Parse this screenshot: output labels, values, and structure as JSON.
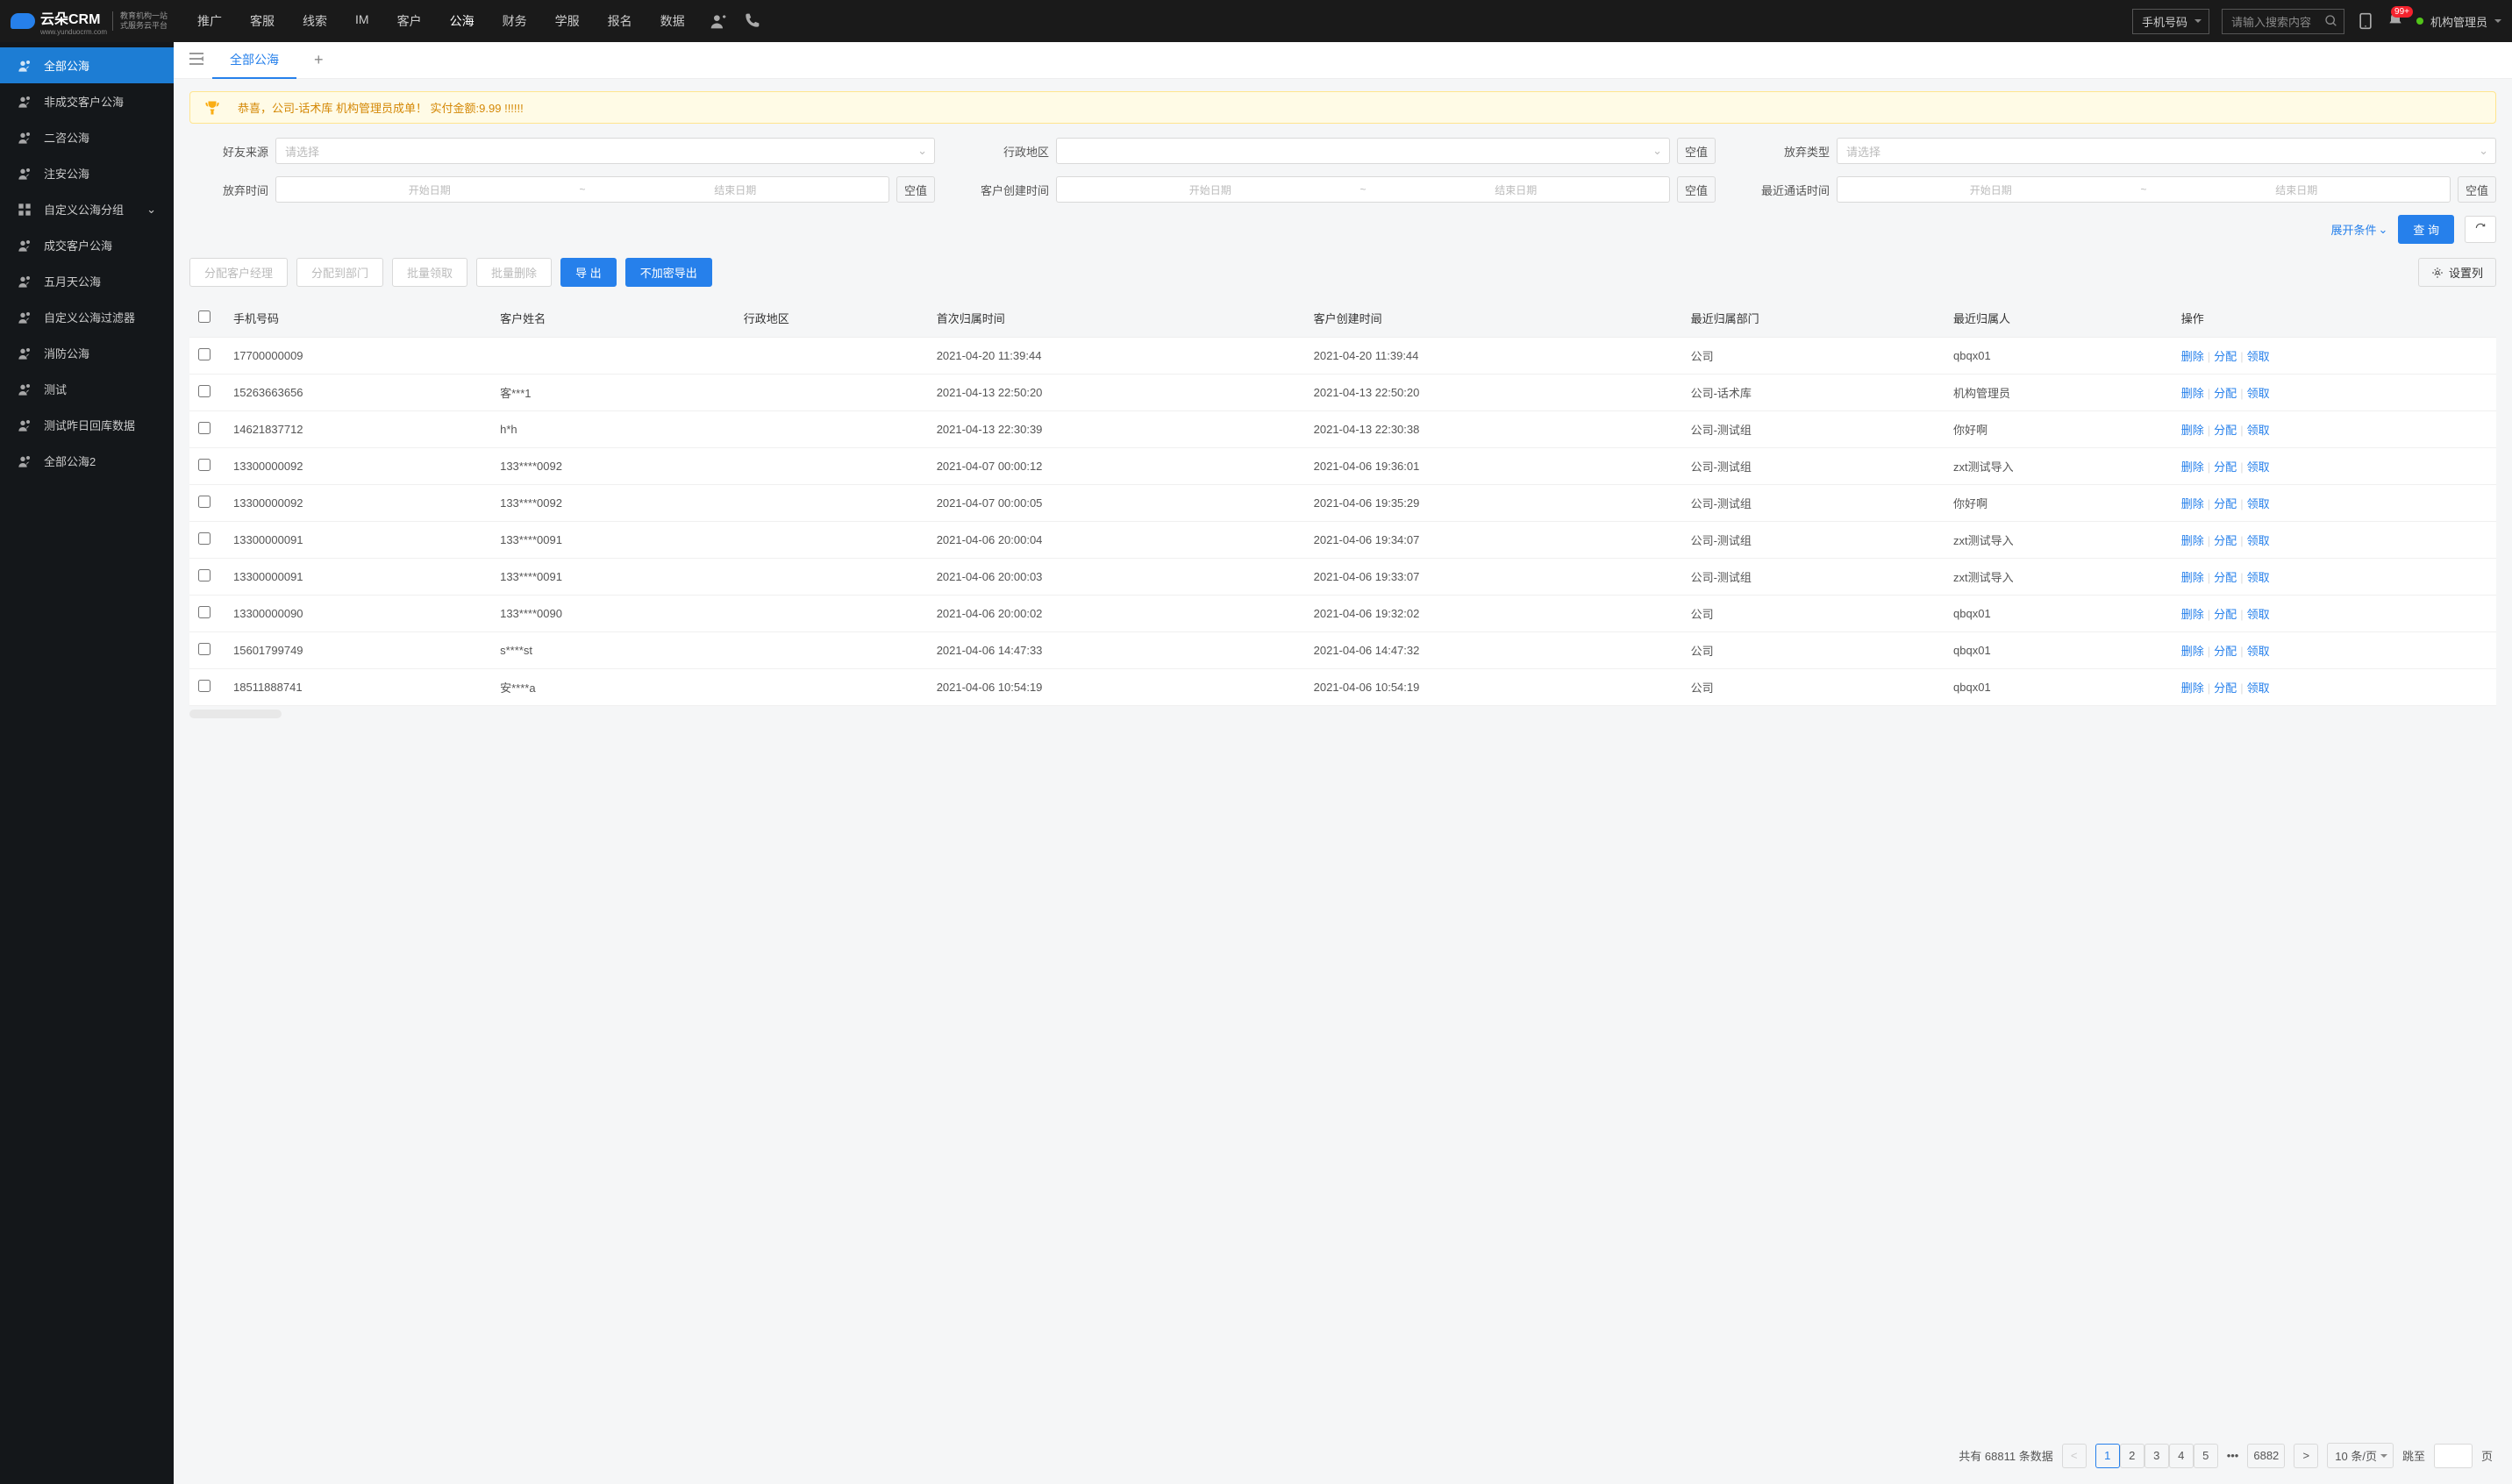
{
  "header": {
    "logo_title": "云朵CRM",
    "logo_url": "www.yunduocrm.com",
    "logo_sub1": "教育机构一站",
    "logo_sub2": "式服务云平台",
    "nav": [
      "推广",
      "客服",
      "线索",
      "IM",
      "客户",
      "公海",
      "财务",
      "学服",
      "报名",
      "数据"
    ],
    "nav_active_index": 5,
    "search_type": "手机号码",
    "search_placeholder": "请输入搜索内容",
    "notif_badge": "99+",
    "user_name": "机构管理员"
  },
  "sidebar": [
    {
      "label": "全部公海",
      "active": true,
      "icon": "people"
    },
    {
      "label": "非成交客户公海",
      "icon": "people"
    },
    {
      "label": "二咨公海",
      "icon": "people"
    },
    {
      "label": "注安公海",
      "icon": "people"
    },
    {
      "label": "自定义公海分组",
      "icon": "grid",
      "expandable": true
    },
    {
      "label": "成交客户公海",
      "icon": "people"
    },
    {
      "label": "五月天公海",
      "icon": "people"
    },
    {
      "label": "自定义公海过滤器",
      "icon": "people"
    },
    {
      "label": "消防公海",
      "icon": "people"
    },
    {
      "label": "测试",
      "icon": "people"
    },
    {
      "label": "测试昨日回库数据",
      "icon": "people"
    },
    {
      "label": "全部公海2",
      "icon": "people"
    }
  ],
  "tabs": {
    "current": "全部公海"
  },
  "alert": "恭喜，公司-话术库  机构管理员成单！  实付金额:9.99 !!!!!!",
  "filters": {
    "f1_label": "好友来源",
    "f1_placeholder": "请选择",
    "f2_label": "行政地区",
    "f2_placeholder": "",
    "f3_label": "放弃类型",
    "f3_placeholder": "请选择",
    "f4_label": "放弃时间",
    "f5_label": "客户创建时间",
    "f6_label": "最近通话时间",
    "date_start": "开始日期",
    "date_end": "结束日期",
    "null_btn": "空值",
    "expand": "展开条件",
    "query": "查 询"
  },
  "actions": {
    "assign_mgr": "分配客户经理",
    "assign_dept": "分配到部门",
    "bulk_get": "批量领取",
    "bulk_del": "批量删除",
    "export": "导 出",
    "export_plain": "不加密导出",
    "set_cols": "设置列"
  },
  "table": {
    "columns": [
      "手机号码",
      "客户姓名",
      "行政地区",
      "首次归属时间",
      "客户创建时间",
      "最近归属部门",
      "最近归属人",
      "操作"
    ],
    "ops": {
      "del": "删除",
      "assign": "分配",
      "get": "领取"
    },
    "rows": [
      {
        "phone": "17700000009",
        "name": "",
        "region": "",
        "first_time": "2021-04-20 11:39:44",
        "create_time": "2021-04-20 11:39:44",
        "dept": "公司",
        "owner": "qbqx01"
      },
      {
        "phone": "15263663656",
        "name": "客***1",
        "region": "",
        "first_time": "2021-04-13 22:50:20",
        "create_time": "2021-04-13 22:50:20",
        "dept": "公司-话术库",
        "owner": "机构管理员"
      },
      {
        "phone": "14621837712",
        "name": "h*h",
        "region": "",
        "first_time": "2021-04-13 22:30:39",
        "create_time": "2021-04-13 22:30:38",
        "dept": "公司-测试组",
        "owner": "你好啊"
      },
      {
        "phone": "13300000092",
        "name": "133****0092",
        "region": "",
        "first_time": "2021-04-07 00:00:12",
        "create_time": "2021-04-06 19:36:01",
        "dept": "公司-测试组",
        "owner": "zxt测试导入"
      },
      {
        "phone": "13300000092",
        "name": "133****0092",
        "region": "",
        "first_time": "2021-04-07 00:00:05",
        "create_time": "2021-04-06 19:35:29",
        "dept": "公司-测试组",
        "owner": "你好啊"
      },
      {
        "phone": "13300000091",
        "name": "133****0091",
        "region": "",
        "first_time": "2021-04-06 20:00:04",
        "create_time": "2021-04-06 19:34:07",
        "dept": "公司-测试组",
        "owner": "zxt测试导入"
      },
      {
        "phone": "13300000091",
        "name": "133****0091",
        "region": "",
        "first_time": "2021-04-06 20:00:03",
        "create_time": "2021-04-06 19:33:07",
        "dept": "公司-测试组",
        "owner": "zxt测试导入"
      },
      {
        "phone": "13300000090",
        "name": "133****0090",
        "region": "",
        "first_time": "2021-04-06 20:00:02",
        "create_time": "2021-04-06 19:32:02",
        "dept": "公司",
        "owner": "qbqx01"
      },
      {
        "phone": "15601799749",
        "name": "s****st",
        "region": "",
        "first_time": "2021-04-06 14:47:33",
        "create_time": "2021-04-06 14:47:32",
        "dept": "公司",
        "owner": "qbqx01"
      },
      {
        "phone": "18511888741",
        "name": "安****a",
        "region": "",
        "first_time": "2021-04-06 10:54:19",
        "create_time": "2021-04-06 10:54:19",
        "dept": "公司",
        "owner": "qbqx01"
      }
    ]
  },
  "pager": {
    "total_prefix": "共有",
    "total": "68811",
    "total_suffix": "条数据",
    "pages": [
      "1",
      "2",
      "3",
      "4",
      "5"
    ],
    "last": "6882",
    "page_size": "10 条/页",
    "jump_label": "跳至",
    "jump_unit": "页"
  }
}
